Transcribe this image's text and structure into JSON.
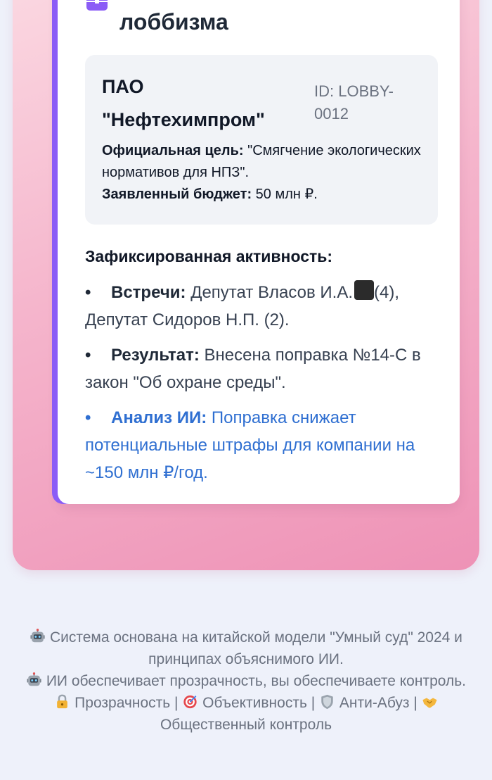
{
  "card": {
    "heading": "Открытый реестр лоббизма",
    "entity": {
      "name": "ПАО \"Нефтехимпром\"",
      "id": "ID: LOBBY-0012",
      "goal_label": "Официальная цель:",
      "goal_value": " \"Смягчение экологических нормативов для НПЗ\".",
      "budget_label": "Заявленный бюджет:",
      "budget_value": " 50 млн ₽."
    },
    "activity_title": "Зафиксированная активность:",
    "activity": {
      "meetings_label": "Встречи:",
      "meetings_value_a": " Депутат Власов И.А.",
      "meetings_value_b": "(4), Депутат Сидоров Н.П. (2).",
      "result_label": "Результат:",
      "result_value": " Внесена поправка №14-С в закон \"Об охране среды\".",
      "ai_label": "Анализ ИИ:",
      "ai_value": " Поправка снижает потенциальные штрафы для компании на ~150 млн ₽/год."
    }
  },
  "footer": {
    "line1": " Система основана на китайской модели \"Умный суд\" 2024 и принципах объяснимого ИИ.",
    "line2": " ИИ обеспечивает прозрачность, вы обеспечиваете контроль.",
    "values": [
      " Прозрачность | ",
      " Объективность | ",
      " Анти-Абуз | ",
      " Общественный контроль"
    ]
  },
  "colors": {
    "accent_purple": "#8b5cf6",
    "ai_blue": "#2f6fd1",
    "panel_pink": "#f5b5cc"
  },
  "icons": [
    "briefcase-icon",
    "stop-icon",
    "robot-icon",
    "lock-icon",
    "target-icon",
    "shield-icon",
    "handshake-icon"
  ]
}
